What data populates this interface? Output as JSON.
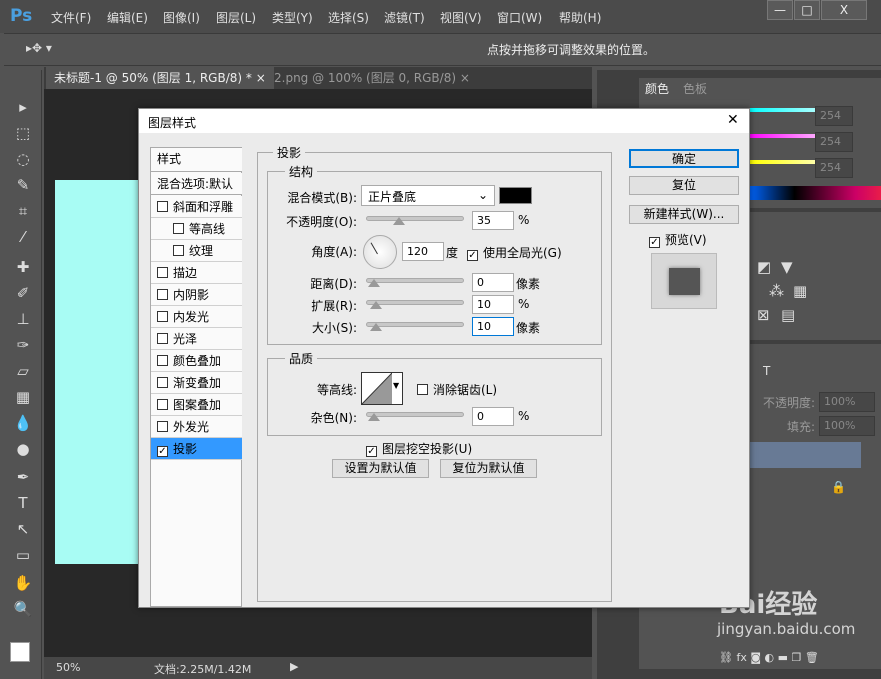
{
  "app": {
    "logo": "Ps",
    "menu": [
      "文件(F)",
      "编辑(E)",
      "图像(I)",
      "图层(L)",
      "类型(Y)",
      "选择(S)",
      "滤镜(T)",
      "视图(V)",
      "窗口(W)",
      "帮助(H)"
    ],
    "window_controls": [
      "—",
      "□",
      "X"
    ]
  },
  "options": {
    "hint": "点按并拖移可调整效果的位置。",
    "tool": "▸✥ ▾"
  },
  "tabs": [
    {
      "label": "未标题-1 @ 50% (图层 1, RGB/8) *",
      "active": true
    },
    {
      "label": "2.png @ 100% (图层 0, RGB/8)",
      "active": false
    }
  ],
  "tab_close": "×",
  "status": {
    "zoom": "50%",
    "doc": "文档:2.25M/1.42M"
  },
  "right": {
    "color_tabs": [
      "颜色",
      "色板"
    ],
    "rgb": [
      "254",
      "254",
      "254"
    ],
    "opacity_label": "不透明度:",
    "opacity": "100%",
    "fill_label": "填充:",
    "fill": "100%"
  },
  "watermark": {
    "brand": "Bai经验",
    "url": "jingyan.baidu.com"
  },
  "dialog": {
    "title": "图层样式",
    "close": "✕",
    "styles_header": "样式",
    "blend_default": "混合选项:默认",
    "items": [
      {
        "label": "斜面和浮雕",
        "checked": false,
        "indent": false
      },
      {
        "label": "等高线",
        "checked": false,
        "indent": true
      },
      {
        "label": "纹理",
        "checked": false,
        "indent": true
      },
      {
        "label": "描边",
        "checked": false,
        "indent": false
      },
      {
        "label": "内阴影",
        "checked": false,
        "indent": false
      },
      {
        "label": "内发光",
        "checked": false,
        "indent": false
      },
      {
        "label": "光泽",
        "checked": false,
        "indent": false
      },
      {
        "label": "颜色叠加",
        "checked": false,
        "indent": false
      },
      {
        "label": "渐变叠加",
        "checked": false,
        "indent": false
      },
      {
        "label": "图案叠加",
        "checked": false,
        "indent": false
      },
      {
        "label": "外发光",
        "checked": false,
        "indent": false
      },
      {
        "label": "投影",
        "checked": true,
        "indent": false,
        "selected": true
      }
    ],
    "section": "投影",
    "structure": "结构",
    "blend_label": "混合模式(B):",
    "blend_value": "正片叠底",
    "shadow_color": "#000000",
    "opacity_label": "不透明度(O):",
    "opacity": "35",
    "opacity_unit": "%",
    "angle_label": "角度(A):",
    "angle": "120",
    "angle_unit": "度",
    "global_light": "使用全局光(G)",
    "global_light_checked": true,
    "distance_label": "距离(D):",
    "distance": "0",
    "distance_unit": "像素",
    "spread_label": "扩展(R):",
    "spread": "10",
    "spread_unit": "%",
    "size_label": "大小(S):",
    "size": "10",
    "size_unit": "像素",
    "quality": "品质",
    "contour_label": "等高线:",
    "antialias": "消除锯齿(L)",
    "antialias_checked": false,
    "noise_label": "杂色(N):",
    "noise": "0",
    "noise_unit": "%",
    "knockout": "图层挖空投影(U)",
    "knockout_checked": true,
    "set_default": "设置为默认值",
    "reset_default": "复位为默认值",
    "ok": "确定",
    "reset": "复位",
    "new_style": "新建样式(W)...",
    "preview": "预览(V)",
    "preview_checked": true
  }
}
